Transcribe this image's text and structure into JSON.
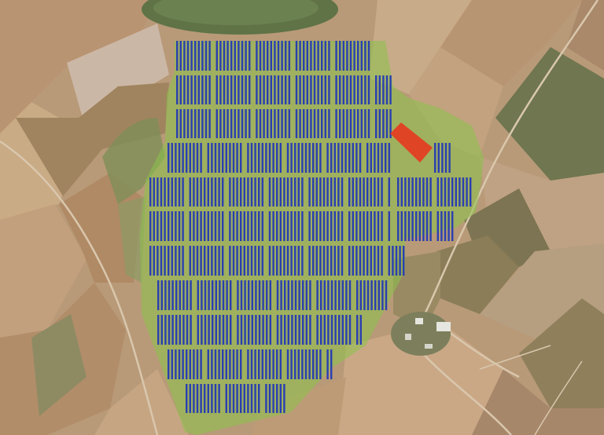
{
  "map": {
    "view": "satellite",
    "colors": {
      "terrain_base": "#b89a78",
      "field_light": "#cdb494",
      "field_dark": "#a78766",
      "field_green": "#8c9a63",
      "orchard": "#7d7a52",
      "forest": "#5f7346",
      "site_overlay": "#8bc34a",
      "panel_fill": "#2a3fb0",
      "panel_stroke": "#1a2a8a",
      "highlight_area": "#e53a1e",
      "road": "#d9c7ad",
      "farm_building": "#e6e6e0"
    }
  }
}
